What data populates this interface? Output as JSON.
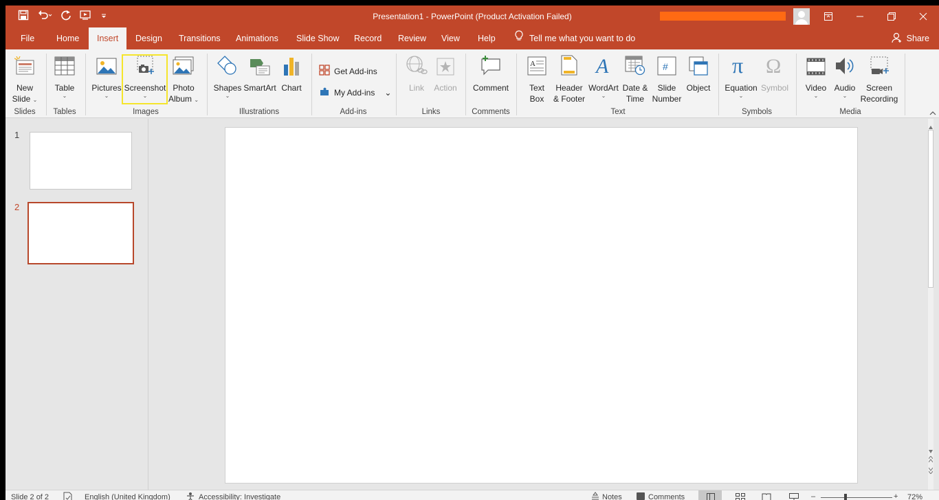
{
  "titlebar": {
    "title": "Presentation1  -  PowerPoint (Product Activation Failed)"
  },
  "tabs": [
    {
      "label": "File"
    },
    {
      "label": "Home"
    },
    {
      "label": "Insert"
    },
    {
      "label": "Design"
    },
    {
      "label": "Transitions"
    },
    {
      "label": "Animations"
    },
    {
      "label": "Slide Show"
    },
    {
      "label": "Record"
    },
    {
      "label": "Review"
    },
    {
      "label": "View"
    },
    {
      "label": "Help"
    }
  ],
  "tell_me": "Tell me what you want to do",
  "share": "Share",
  "ribbon": {
    "slides": {
      "new_slide": [
        "New",
        "Slide"
      ],
      "label": "Slides"
    },
    "tables": {
      "table": "Table",
      "label": "Tables"
    },
    "images": {
      "pictures": "Pictures",
      "screenshot": "Screenshot",
      "photo_album": [
        "Photo",
        "Album"
      ],
      "label": "Images"
    },
    "illustrations": {
      "shapes": "Shapes",
      "smartart": "SmartArt",
      "chart": "Chart",
      "label": "Illustrations"
    },
    "addins": {
      "get_addins": "Get Add-ins",
      "my_addins": "My Add-ins",
      "label": "Add-ins"
    },
    "links": {
      "link": "Link",
      "action": "Action",
      "label": "Links"
    },
    "comments": {
      "comment": "Comment",
      "label": "Comments"
    },
    "text": {
      "text_box": [
        "Text",
        "Box"
      ],
      "header_footer": [
        "Header",
        "& Footer"
      ],
      "wordart": "WordArt",
      "date_time": [
        "Date &",
        "Time"
      ],
      "slide_number": [
        "Slide",
        "Number"
      ],
      "object": "Object",
      "label": "Text"
    },
    "symbols": {
      "equation": "Equation",
      "symbol": "Symbol",
      "label": "Symbols"
    },
    "media": {
      "video": "Video",
      "audio": "Audio",
      "screen_recording": [
        "Screen",
        "Recording"
      ],
      "label": "Media"
    }
  },
  "thumbnails": [
    {
      "number": "1"
    },
    {
      "number": "2"
    }
  ],
  "status": {
    "slide_of": "Slide 2 of 2",
    "language": "English (United Kingdom)",
    "accessibility": "Accessibility: Investigate",
    "notes": "Notes",
    "comments": "Comments",
    "zoom": "72%"
  },
  "colors": {
    "accent": "#c1472a",
    "highlight": "#f5e52b",
    "account_bar": "#ff6a13"
  }
}
